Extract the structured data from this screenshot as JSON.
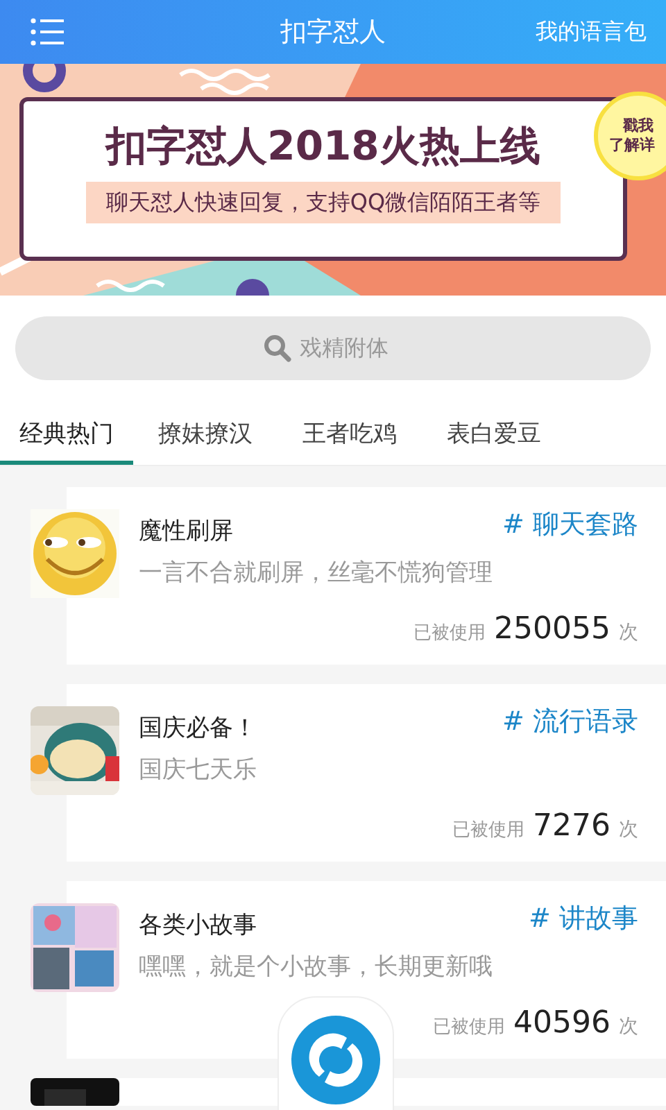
{
  "header": {
    "title": "扣字怼人",
    "action": "我的语言包"
  },
  "banner": {
    "headline": "扣字怼人2018火热上线",
    "subline": "聊天怼人快速回复，支持QQ微信陌陌王者等",
    "bubble": [
      "戳我",
      "了解详"
    ]
  },
  "search": {
    "placeholder": "戏精附体"
  },
  "tabs": [
    {
      "label": "经典热门",
      "selected": true
    },
    {
      "label": "撩妹撩汉",
      "selected": false
    },
    {
      "label": "王者吃鸡",
      "selected": false
    },
    {
      "label": "表白爱豆",
      "selected": false
    }
  ],
  "cards": [
    {
      "title": "魔性刷屏",
      "tag": "# 聊天套路",
      "desc": "一言不合就刷屏，丝毫不慌狗管理",
      "used_label": "已被使用",
      "count": "250055",
      "unit": "次",
      "kind": "picture"
    },
    {
      "title": "国庆必备！",
      "tag": "# 流行语录",
      "desc": "国庆七天乐",
      "used_label": "已被使用",
      "count": "7276",
      "unit": "次",
      "kind": "picture"
    },
    {
      "title": "各类小故事",
      "tag": "# 讲故事",
      "desc": "嘿嘿，就是个小故事，长期更新哦",
      "used_label": "已被使用",
      "count": "40596",
      "unit": "次",
      "kind": "picture"
    },
    {
      "kind": "picture"
    }
  ]
}
